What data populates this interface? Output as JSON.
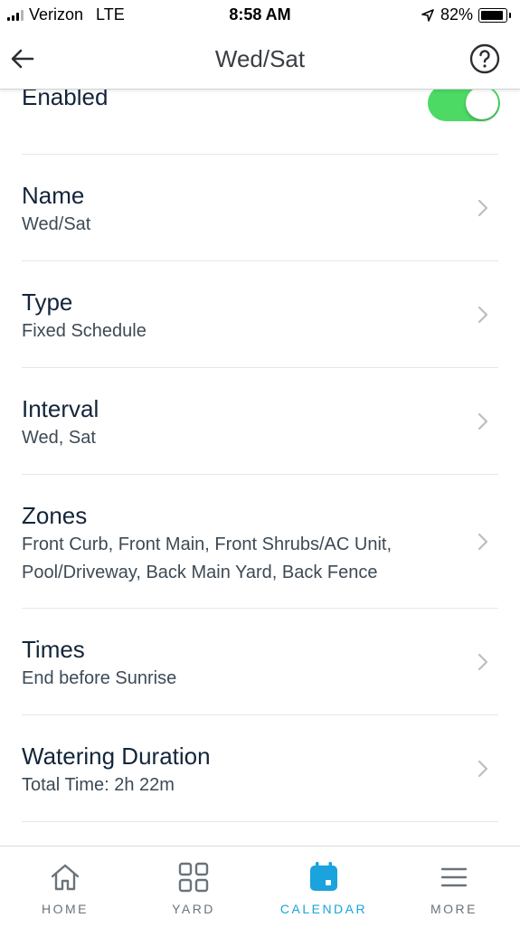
{
  "status_bar": {
    "carrier": "Verizon",
    "network": "LTE",
    "time": "8:58 AM",
    "battery": "82%",
    "battery_level": 0.82
  },
  "header": {
    "title": "Wed/Sat",
    "back_icon": "arrow-left-icon",
    "help_icon": "question-circle-icon"
  },
  "enabled": {
    "label": "Enabled",
    "on": true,
    "accent": "#4cd964"
  },
  "rows": [
    {
      "title": "Name",
      "subtitle": "Wed/Sat"
    },
    {
      "title": "Type",
      "subtitle": "Fixed Schedule"
    },
    {
      "title": "Interval",
      "subtitle": "Wed, Sat"
    },
    {
      "title": "Zones",
      "subtitle": "Front Curb, Front Main, Front Shrubs/AC Unit, Pool/Driveway, Back Main Yard, Back Fence"
    },
    {
      "title": "Times",
      "subtitle": "End before Sunrise"
    },
    {
      "title": "Watering Duration",
      "subtitle": "Total Time: 2h 22m"
    }
  ],
  "tabbar": {
    "active_color": "#1aa3dd",
    "items": [
      {
        "label": "HOME",
        "icon": "house-icon"
      },
      {
        "label": "YARD",
        "icon": "grid-icon"
      },
      {
        "label": "CALENDAR",
        "icon": "calendar-icon",
        "active": true
      },
      {
        "label": "MORE",
        "icon": "menu-icon"
      }
    ]
  }
}
